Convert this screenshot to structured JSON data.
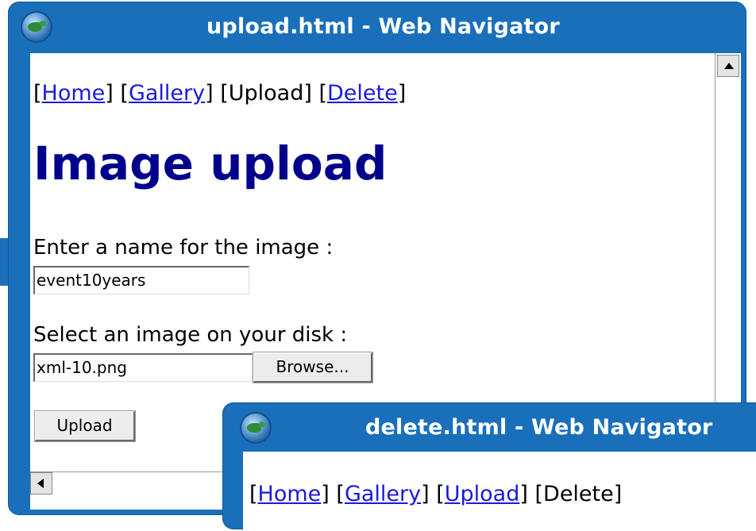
{
  "windows": {
    "upload": {
      "title": "upload.html - Web Navigator",
      "nav": {
        "open_bracket": "[",
        "home": "Home",
        "sep1": "] [",
        "gallery": "Gallery",
        "sep2": "] [Upload] [",
        "delete": "Delete",
        "close_bracket": "]"
      },
      "heading": "Image upload",
      "name_label": "Enter a name for the image :",
      "name_value": "event10years",
      "file_label": "Select an image on your disk :",
      "file_value": "xml-10.png",
      "browse_label": "Browse...",
      "upload_label": "Upload"
    },
    "delete": {
      "title": "delete.html - Web Navigator",
      "nav": {
        "open_bracket": "[",
        "home": "Home",
        "sep1": "] [",
        "gallery": "Gallery",
        "sep2": "] [",
        "upload": "Upload",
        "sep3": "] [Delete]"
      }
    }
  },
  "icons": {
    "window_icon": "globe-icon",
    "scroll_up": "arrow-up-icon",
    "scroll_left": "arrow-left-icon"
  },
  "colors": {
    "titlebar": "#1a6fbb",
    "heading": "#00008b",
    "link": "#1a1adb"
  }
}
